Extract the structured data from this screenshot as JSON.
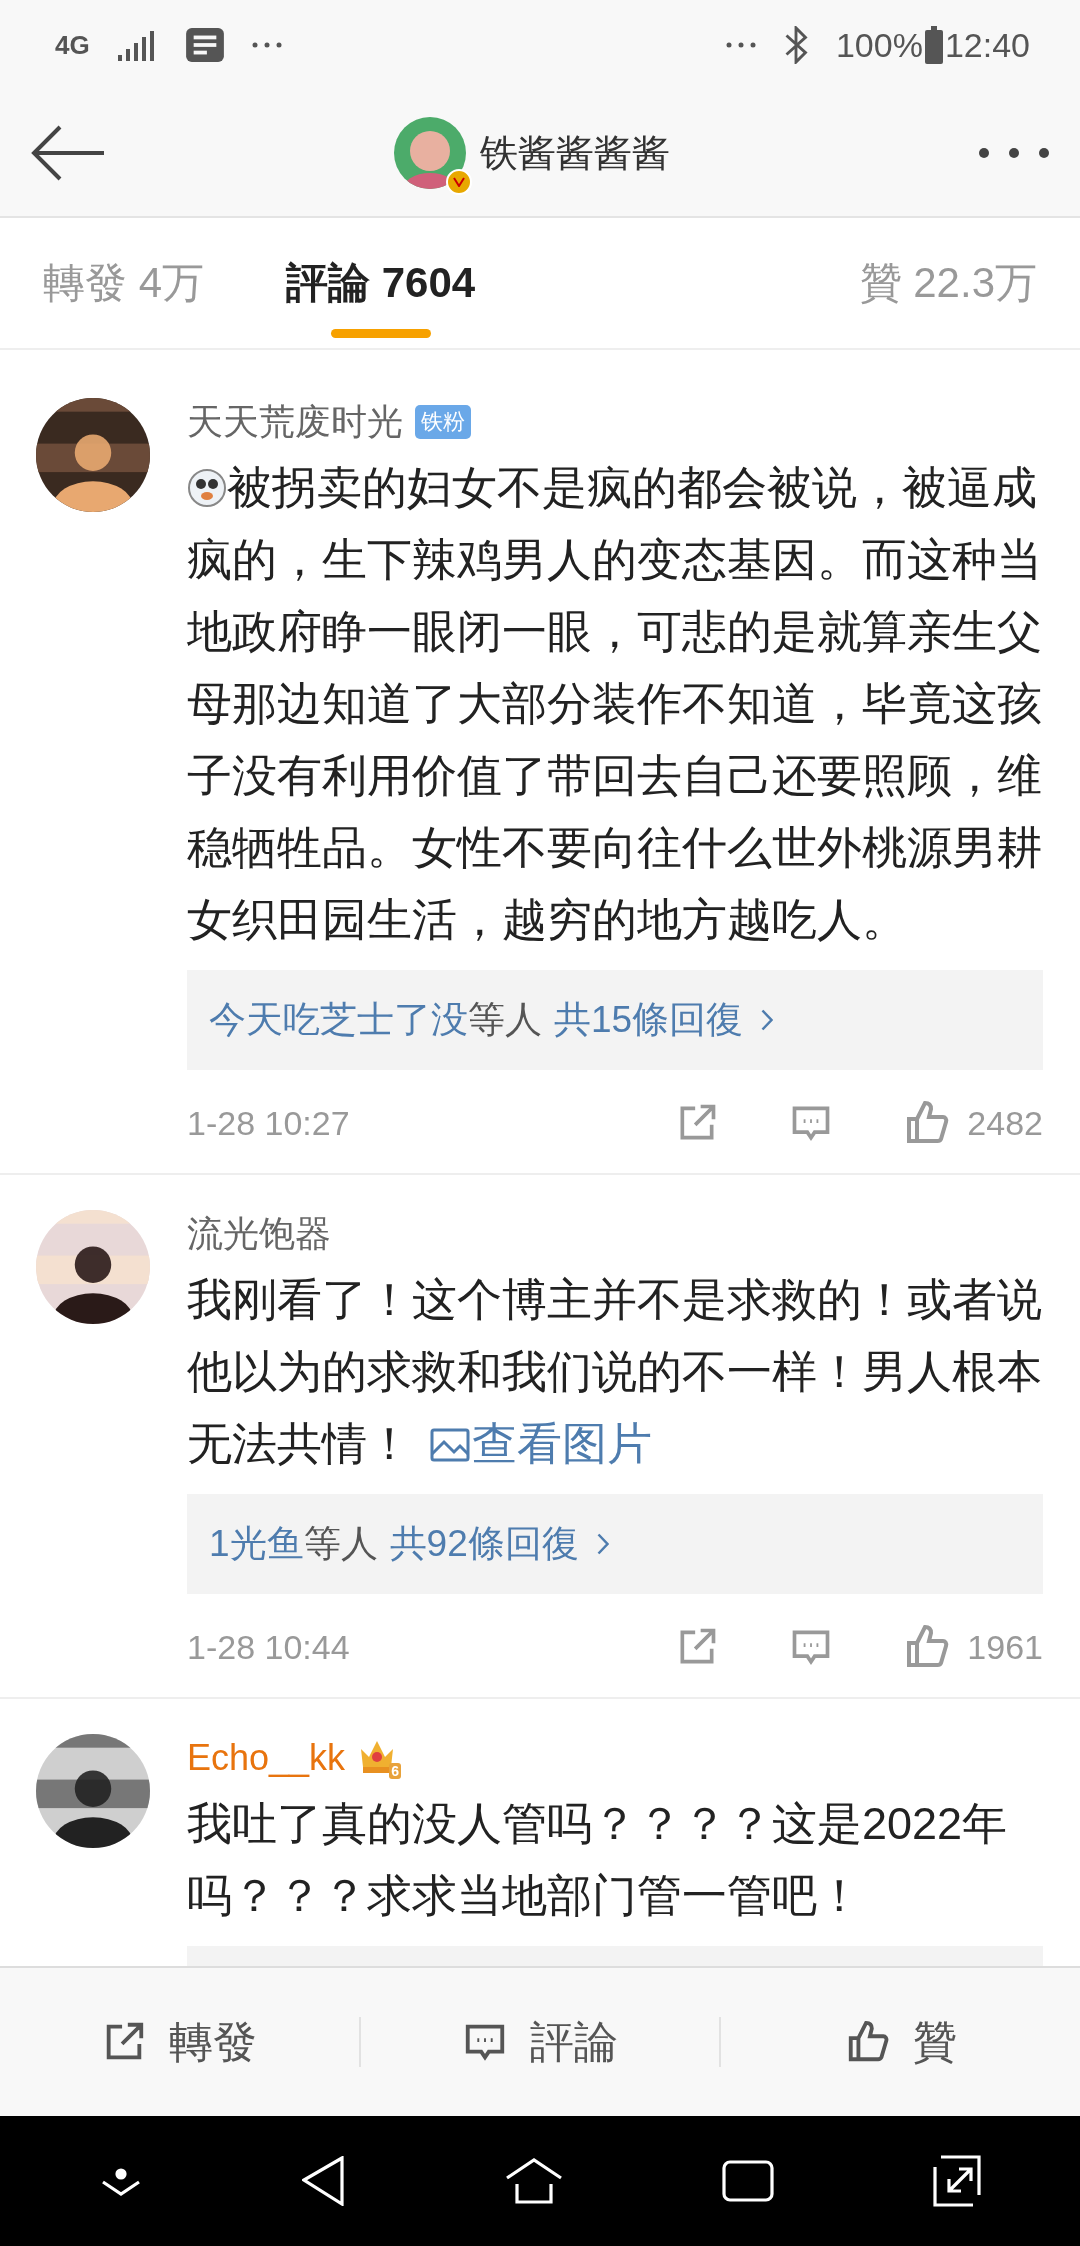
{
  "status_bar": {
    "network": "4G",
    "battery": "100%",
    "time": "12:40"
  },
  "header": {
    "title": "铁酱酱酱酱",
    "verified": true
  },
  "tabs": [
    {
      "label": "轉發 4万",
      "selected": false
    },
    {
      "label": "評論 7604",
      "selected": true
    },
    {
      "label": "贊 22.3万",
      "selected": false
    }
  ],
  "comments": [
    {
      "name": "天天荒废时光",
      "member": false,
      "badge": "铁粉",
      "emoji": true,
      "text": "被拐卖的妇女不是疯的都会被说，被逼成疯的，生下辣鸡男人的变态基因。而这种当地政府睁一眼闭一眼，可悲的是就算亲生父母那边知道了大部分装作不知道，毕竟这孩子没有利用价值了带回去自己还要照顾，维稳牺牲品。女性不要向往什么世外桃源男耕女织田园生活，越穷的地方越吃人。",
      "reply": {
        "user": "今天吃芝士了没",
        "middle": "等人",
        "total": "共15條回復"
      },
      "time": "1-28 10:27",
      "likes": "2482"
    },
    {
      "name": "流光饱器",
      "member": false,
      "text": "我刚看了！这个博主并不是求救的！或者说他以为的求救和我们说的不一样！男人根本无法共情！",
      "link": "查看图片",
      "reply": {
        "user": "1光鱼",
        "middle": "等人",
        "total": "共92條回復"
      },
      "time": "1-28 10:44",
      "likes": "1961"
    },
    {
      "name": "Echo__kk",
      "member": true,
      "crown_level": "6",
      "text": "我吐了真的没人管吗？？？？这是2022年吗？？？求求当地部门管一管吧！"
    }
  ],
  "actions": [
    {
      "kind": "share",
      "label": "轉發"
    },
    {
      "kind": "comment",
      "label": "評論"
    },
    {
      "kind": "like",
      "label": "贊"
    }
  ]
}
